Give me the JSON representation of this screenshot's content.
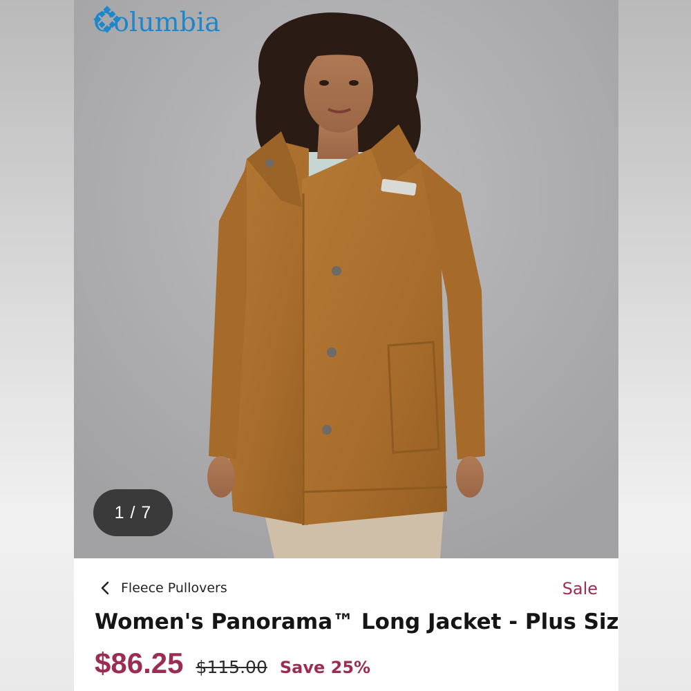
{
  "brand": {
    "name": "Columbia",
    "icon": "columbia-diamond-logo-icon",
    "color": "#1d87c9"
  },
  "gallery": {
    "counter": "1 / 7",
    "image": "product-photo-woman-in-brown-sherpa-long-jacket"
  },
  "breadcrumb": {
    "label": "Fleece Pullovers",
    "icon": "chevron-left-icon"
  },
  "badge": {
    "sale": "Sale"
  },
  "product": {
    "title": "Women's Panorama™ Long Jacket - Plus Size",
    "price_now": "$86.25",
    "price_was": "$115.00",
    "savings": "Save 25%"
  },
  "colors": {
    "accent": "#9b2d55",
    "counter_bg": "#3a3a3b"
  }
}
